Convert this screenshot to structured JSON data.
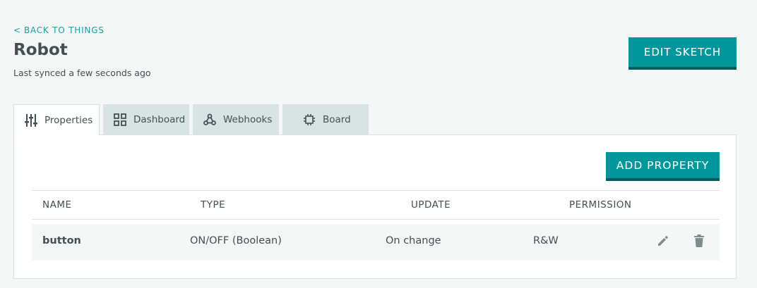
{
  "header": {
    "back_chevron": "<",
    "back_label": "BACK TO THINGS",
    "title": "Robot",
    "sync_status": "Last synced a few seconds ago",
    "edit_sketch_label": "EDIT SKETCH"
  },
  "tabs": [
    {
      "label": "Properties",
      "icon": "sliders-icon",
      "active": true
    },
    {
      "label": "Dashboard",
      "icon": "grid-icon",
      "active": false
    },
    {
      "label": "Webhooks",
      "icon": "webhook-icon",
      "active": false
    },
    {
      "label": "Board",
      "icon": "chip-icon",
      "active": false
    }
  ],
  "properties": {
    "add_label": "ADD PROPERTY",
    "columns": [
      "NAME",
      "TYPE",
      "UPDATE",
      "PERMISSION"
    ],
    "rows": [
      {
        "name": "button",
        "type": "ON/OFF (Boolean)",
        "update": "On change",
        "permission": "R&W"
      }
    ]
  },
  "colors": {
    "accent": "#00979c",
    "accent_dark": "#005c5f",
    "link": "#14a0a3",
    "text": "#434f54",
    "tab_inactive": "#dae3e3",
    "icon_gray": "#7f8c8d"
  }
}
